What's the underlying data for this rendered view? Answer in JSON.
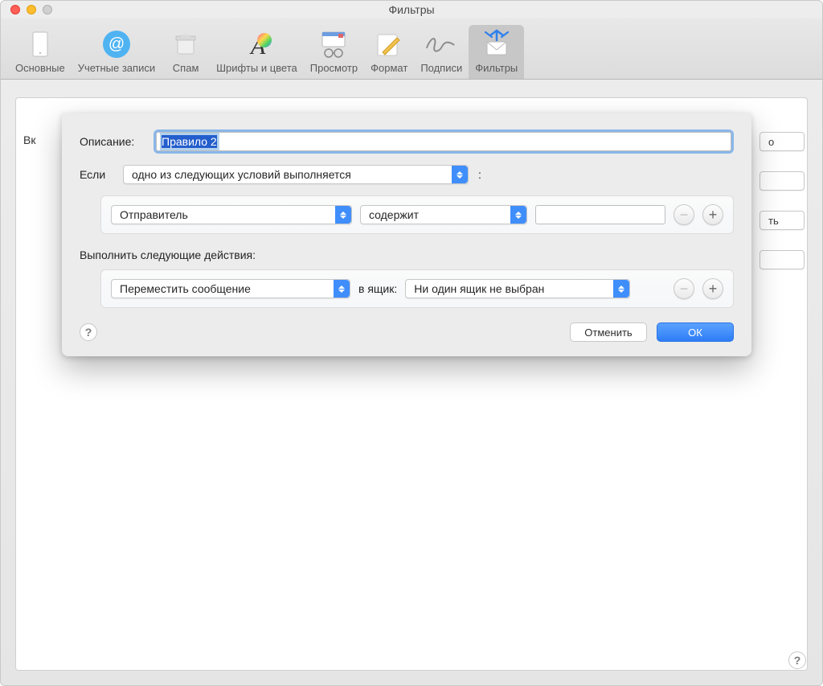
{
  "window": {
    "title": "Фильтры"
  },
  "toolbar": {
    "items": [
      {
        "label": "Основные"
      },
      {
        "label": "Учетные записи"
      },
      {
        "label": "Спам"
      },
      {
        "label": "Шрифты и цвета"
      },
      {
        "label": "Просмотр"
      },
      {
        "label": "Формат"
      },
      {
        "label": "Подписи"
      },
      {
        "label": "Фильтры"
      }
    ]
  },
  "background": {
    "left_peek": "Вк",
    "right_peek_1": "о",
    "right_peek_2": "ть"
  },
  "sheet": {
    "description_label": "Описание:",
    "description_value": "Правило 2",
    "if_label": "Если",
    "if_colon": ":",
    "condition_match": "одно из следующих условий выполняется",
    "condition_field": "Отправитель",
    "condition_op": "содержит",
    "condition_value": "",
    "actions_title": "Выполнить следующие действия:",
    "action_verb": "Переместить сообщение",
    "action_to_label": "в ящик:",
    "action_mailbox": "Ни один ящик не выбран",
    "cancel": "Отменить",
    "ok": "ОК"
  }
}
